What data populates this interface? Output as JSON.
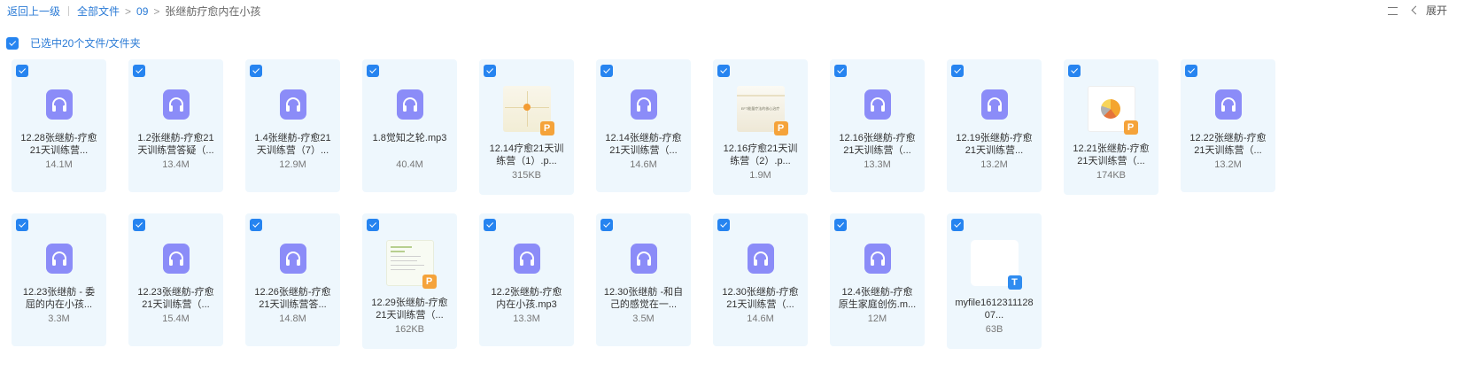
{
  "topbar": {
    "back_label": "返回上一级",
    "breadcrumbs": [
      {
        "label": "全部文件"
      },
      {
        "label": "09"
      },
      {
        "label": "张继舫疗愈内在小孩"
      }
    ],
    "expand_label": "展开"
  },
  "selection": {
    "label": "已选中20个文件/文件夹"
  },
  "rows": [
    [
      {
        "type": "audio",
        "name": "12.28张继舫-疗愈21天训练营...",
        "size": "14.1M"
      },
      {
        "type": "audio",
        "name": "1.2张继舫-疗愈21天训练营答疑（...",
        "size": "13.4M"
      },
      {
        "type": "audio",
        "name": "1.4张继舫-疗愈21天训练营（7）...",
        "size": "12.9M"
      },
      {
        "type": "audio",
        "name": "1.8觉知之轮.mp3",
        "size": "40.4M"
      },
      {
        "type": "ppt",
        "thumb": "a",
        "name": "12.14疗愈21天训练营（1）.p...",
        "size": "315KB"
      },
      {
        "type": "audio",
        "name": "12.14张继舫-疗愈21天训练营（...",
        "size": "14.6M"
      },
      {
        "type": "ppt",
        "thumb": "b",
        "thumb_text": "EFT能量疗法的核心治疗",
        "name": "12.16疗愈21天训练营（2）.p...",
        "size": "1.9M"
      },
      {
        "type": "audio",
        "name": "12.16张继舫-疗愈21天训练营（...",
        "size": "13.3M"
      },
      {
        "type": "audio",
        "name": "12.19张继舫-疗愈21天训练营...",
        "size": "13.2M"
      },
      {
        "type": "ppt",
        "thumb": "c",
        "name": "12.21张继舫-疗愈21天训练营（...",
        "size": "174KB"
      },
      {
        "type": "audio",
        "name": "12.22张继舫-疗愈21天训练营（...",
        "size": "13.2M"
      }
    ],
    [
      {
        "type": "audio",
        "name": "12.23张继舫 - 委屈的内在小孩...",
        "size": "3.3M"
      },
      {
        "type": "audio",
        "name": "12.23张继舫-疗愈21天训练营（...",
        "size": "15.4M"
      },
      {
        "type": "audio",
        "name": "12.26张继舫-疗愈21天训练营答...",
        "size": "14.8M"
      },
      {
        "type": "ppt",
        "thumb": "d",
        "name": "12.29张继舫-疗愈21天训练营（...",
        "size": "162KB"
      },
      {
        "type": "audio",
        "name": "12.2张继舫-疗愈内在小孩.mp3",
        "size": "13.3M"
      },
      {
        "type": "audio",
        "name": "12.30张继舫 -和自己的感觉在一...",
        "size": "3.5M"
      },
      {
        "type": "audio",
        "name": "12.30张继舫-疗愈21天训练营（...",
        "size": "14.6M"
      },
      {
        "type": "audio",
        "name": "12.4张继舫-疗愈原生家庭创伤.m...",
        "size": "12M"
      },
      {
        "type": "txt",
        "name": "myfile161231112807...",
        "size": "63B"
      }
    ]
  ],
  "icons": {
    "audio_color": "#8b8cf8",
    "ppt_badge_color": "#f5a33a",
    "ppt_badge_letter": "P",
    "txt_badge_color": "#2f8cf0",
    "txt_badge_letter": "T",
    "checkbox_color": "#2684f0"
  }
}
